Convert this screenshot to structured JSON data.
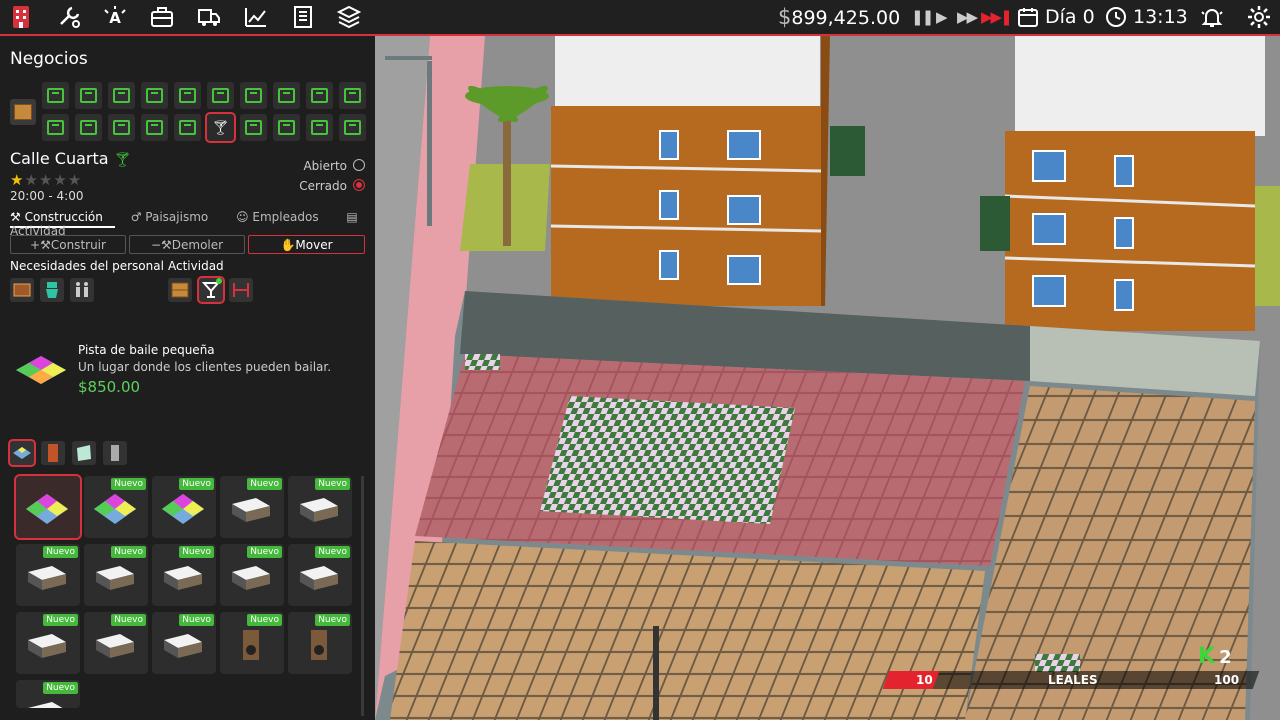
{
  "topbar": {
    "money": "899,425.00",
    "currency_symbol": "$",
    "day": "Día 0",
    "time": "13:13",
    "icons": [
      "business-icon",
      "tools-icon",
      "marketing-icon",
      "briefcase-icon",
      "delivery-icon",
      "stats-icon",
      "ledger-icon",
      "layers-icon"
    ],
    "speed_icons": [
      "pause-icon",
      "play-icon",
      "fast-forward-icon",
      "fastest-icon"
    ],
    "accent": "#d6313c"
  },
  "panel": {
    "title": "Negocios",
    "business_name": "Calle Cuarta",
    "stars": "★",
    "stars_off": "★★★★",
    "rating": 1,
    "hours": "20:00 - 4:00",
    "open_label": "Abierto",
    "closed_label": "Cerrado",
    "tabs": [
      "Construcción",
      "Paisajismo",
      "Empleados",
      "Actividad"
    ],
    "actions": [
      "Construir",
      "Demoler",
      "Mover"
    ],
    "staff_label": "Necesidades del personal",
    "activity_label": "Actividad"
  },
  "selected_item": {
    "name": "Pista de baile pequeña",
    "description": "Un lugar donde los clientes pueden bailar.",
    "price": "$850.00"
  },
  "catalog": {
    "new_label": "Nuevo"
  },
  "hud": {
    "loyal_label": "LEALES",
    "loyal_value": "10",
    "loyal_max": "100",
    "k_count": "2",
    "k_symbol": "K"
  }
}
